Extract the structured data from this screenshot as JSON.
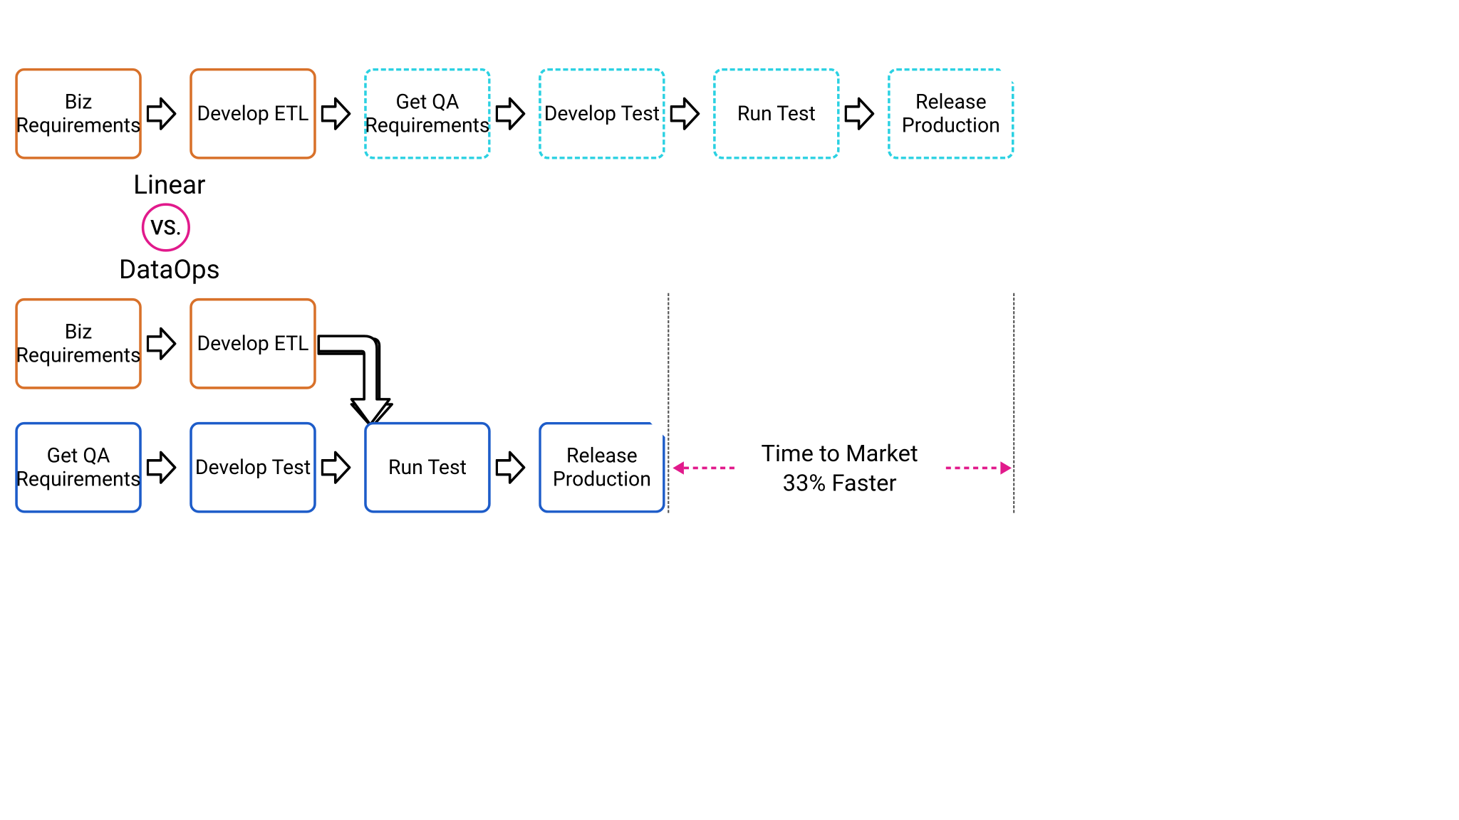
{
  "linear": {
    "label": "Linear",
    "steps": [
      "Biz Requirements",
      "Develop ETL",
      "Get QA Requirements",
      "Develop Test",
      "Run Test",
      "Release Production"
    ]
  },
  "vs_label": "VS.",
  "dataops": {
    "label": "DataOps",
    "top_steps": [
      "Biz Requirements",
      "Develop ETL"
    ],
    "bottom_steps": [
      "Get QA Requirements",
      "Develop Test",
      "Run Test",
      "Release Production"
    ]
  },
  "time_to_market": {
    "line1": "Time to Market",
    "line2": "33% Faster"
  }
}
